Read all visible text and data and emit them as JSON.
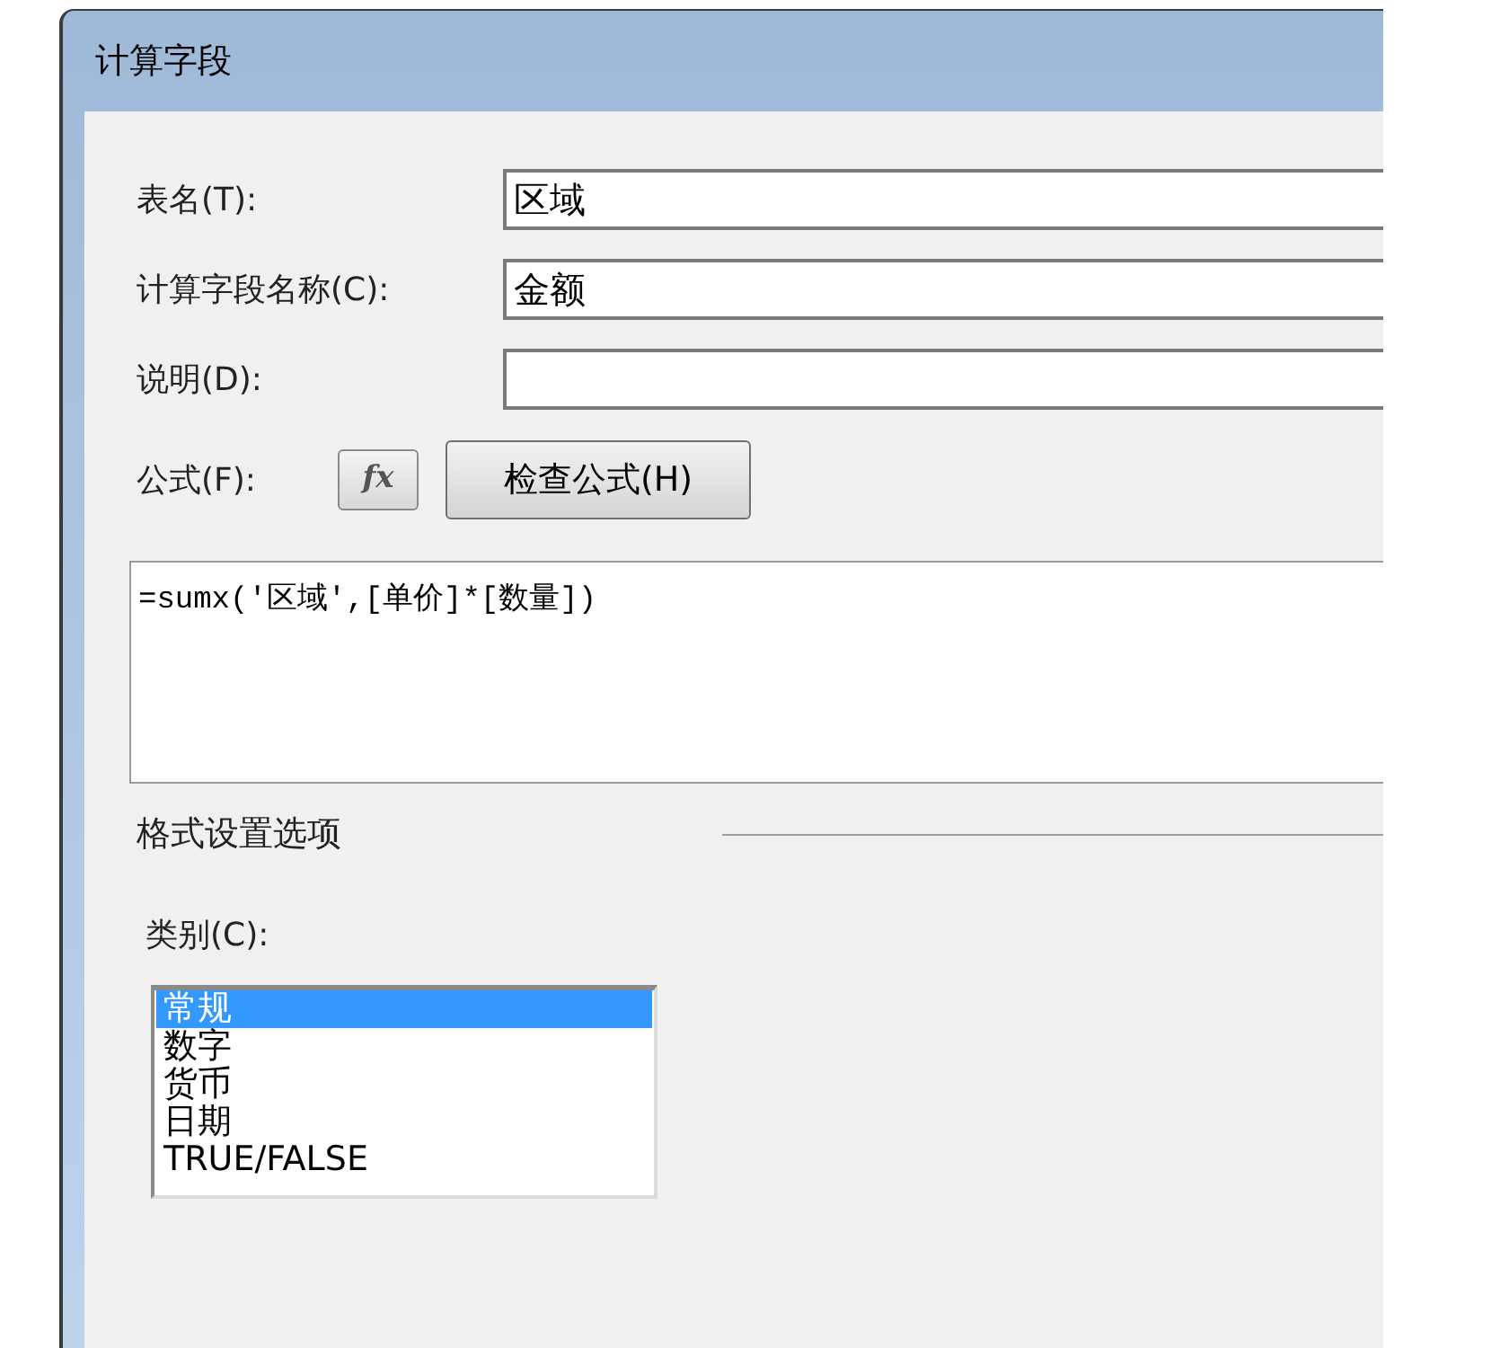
{
  "window": {
    "title": "计算字段"
  },
  "fields": [
    {
      "label": "表名(T):",
      "value": "区域"
    },
    {
      "label": "计算字段名称(C):",
      "value": "金额"
    },
    {
      "label": "说明(D):"
    }
  ],
  "formula": {
    "label": "公式(F):",
    "fx_button": "fx",
    "check_button": "检查公式(H)",
    "value": "=sumx('区域',[单价]*[数量])"
  },
  "format_section": {
    "title": "格式设置选项",
    "category_label": "类别(C):",
    "categories": [
      {
        "label": "常规",
        "selected": true
      },
      {
        "label": "数字",
        "selected": false
      },
      {
        "label": "货币",
        "selected": false
      },
      {
        "label": "日期",
        "selected": false
      },
      {
        "label": "TRUE/FALSE",
        "selected": false
      }
    ]
  }
}
